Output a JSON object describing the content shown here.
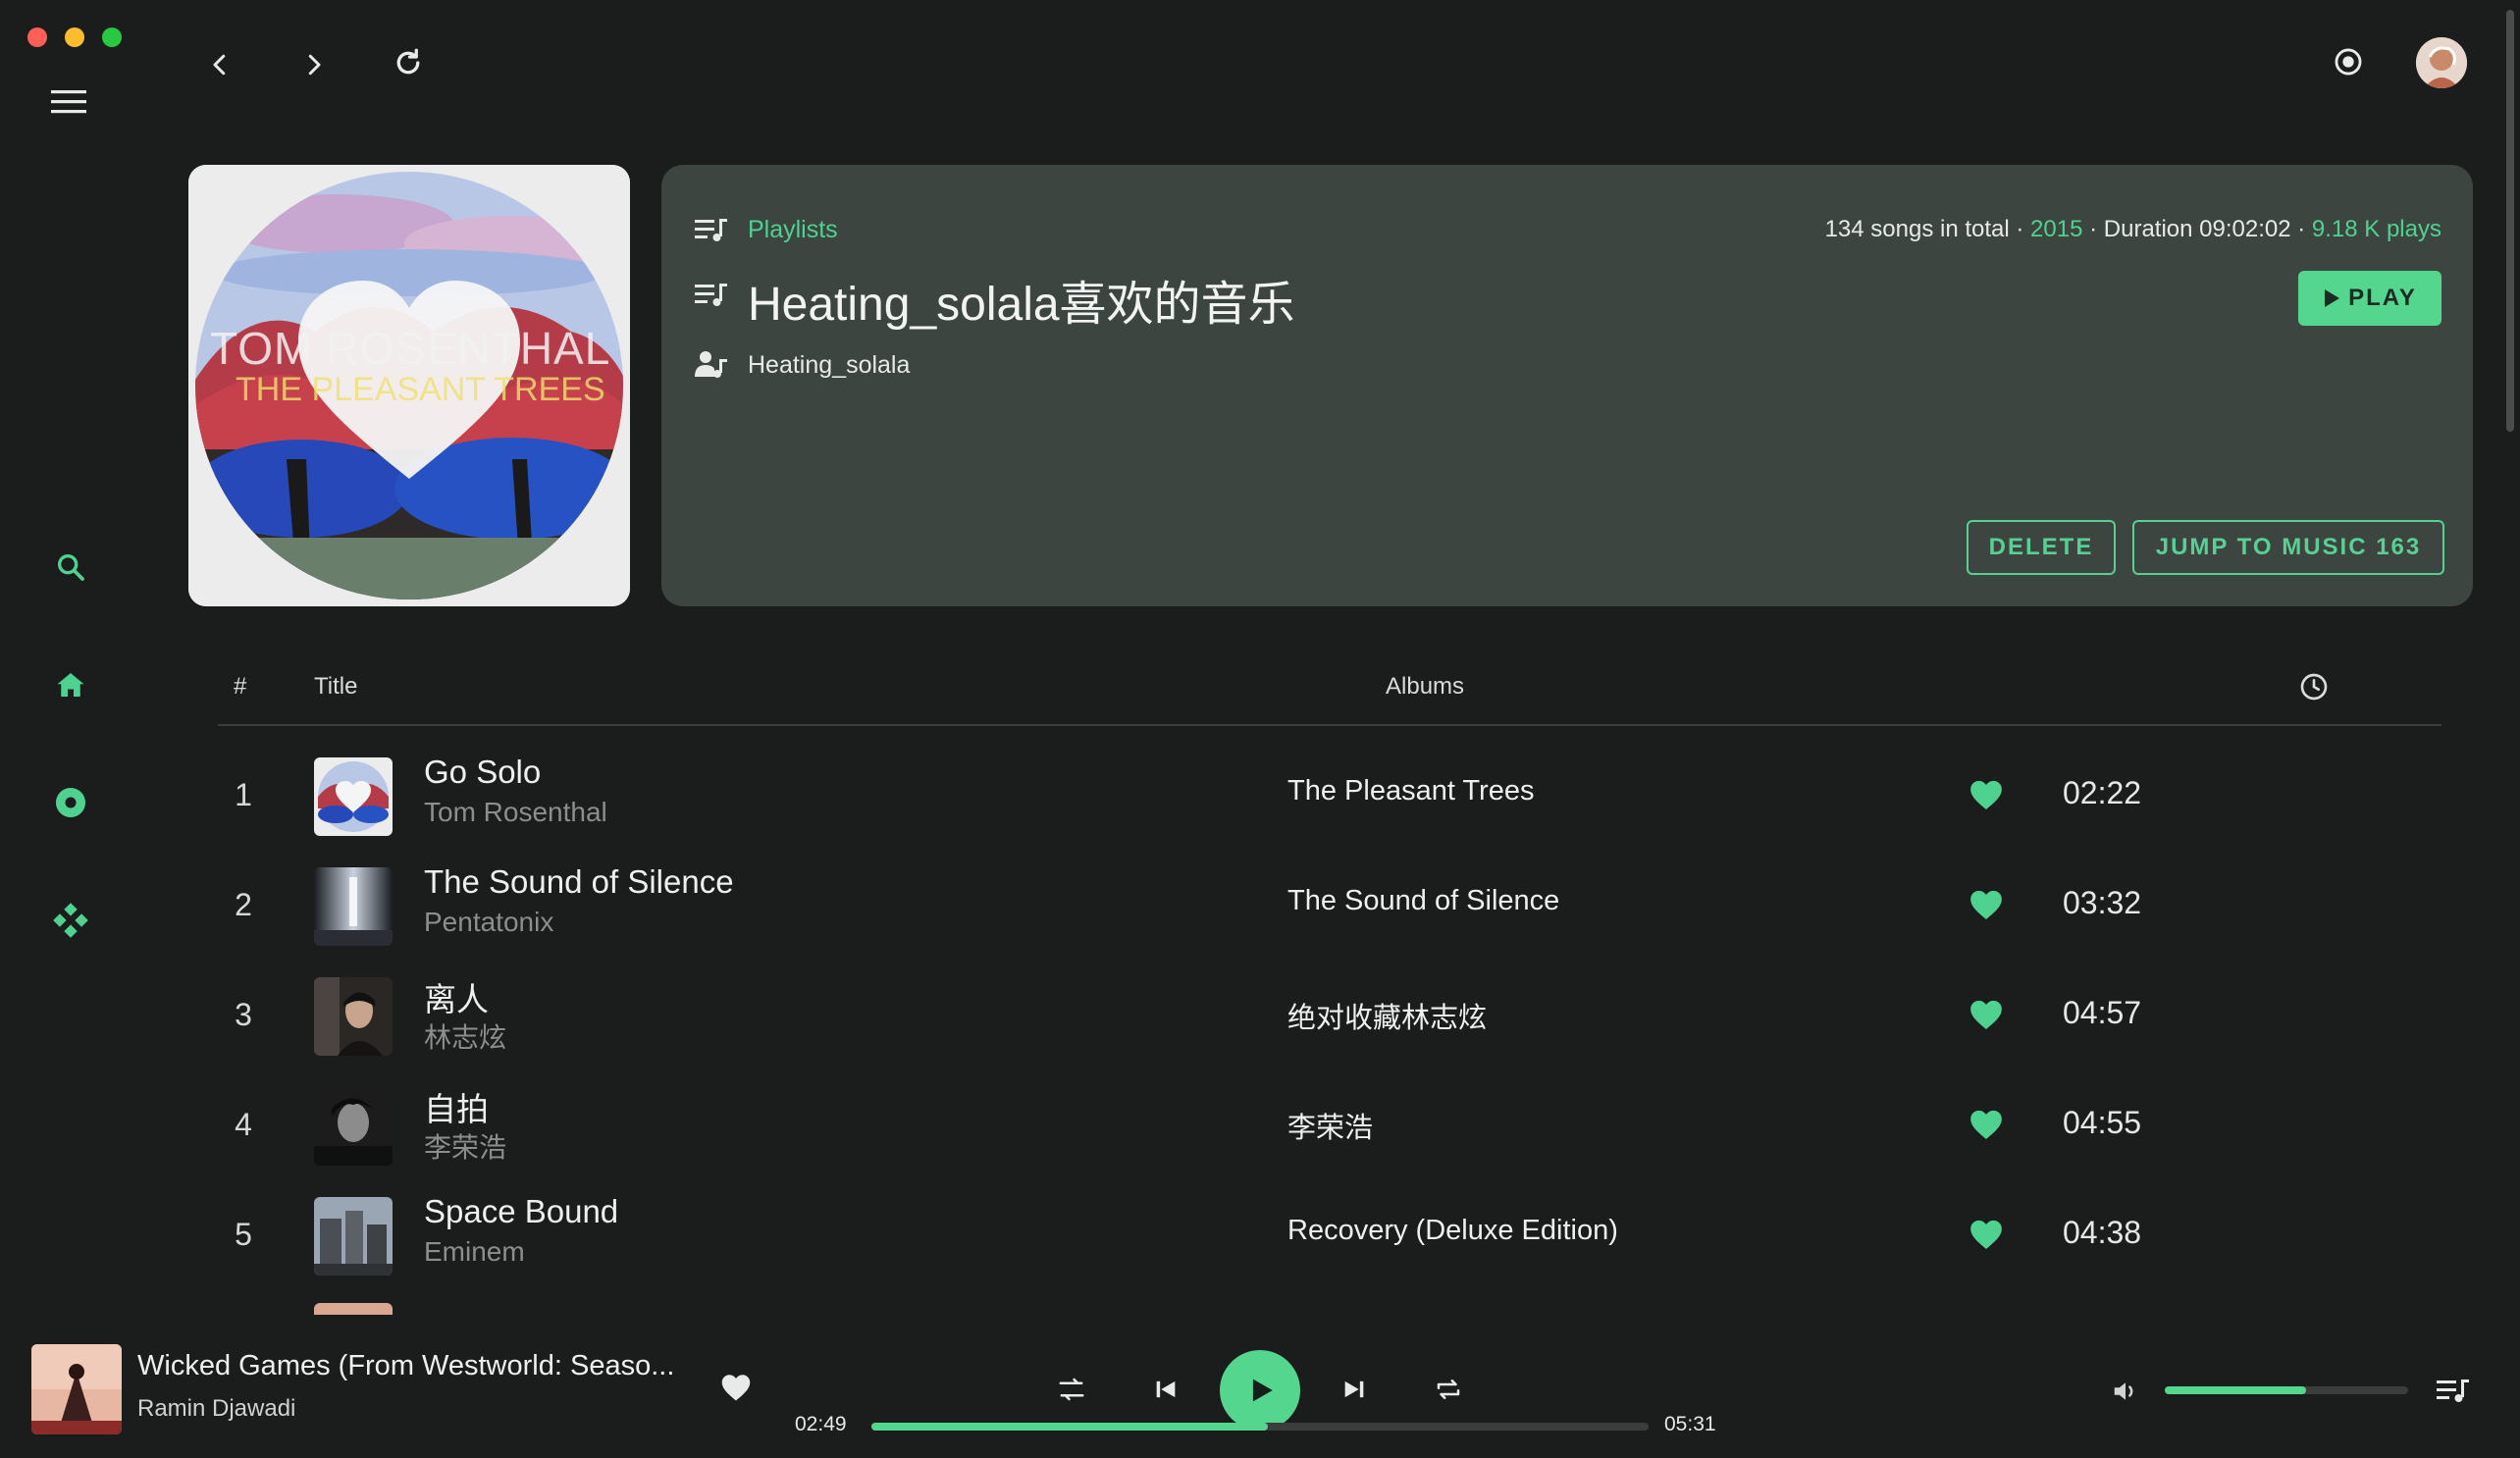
{
  "playlist": {
    "section_label": "Playlists",
    "name": "Heating_solala喜欢的音乐",
    "creator": "Heating_solala",
    "cover_title_line1": "TOM ROSENTHAL",
    "cover_title_line2": "THE PLEASANT TREES",
    "stats_count": "134 songs in total",
    "stats_sep1": " · ",
    "stats_year": "2015",
    "stats_sep2": " · ",
    "stats_duration": "Duration 09:02:02",
    "stats_sep3": " · ",
    "stats_plays": "9.18 K plays",
    "play_label": "PLAY",
    "delete_label": "DELETE",
    "jump_label": "JUMP TO MUSIC 163"
  },
  "table": {
    "col_num": "#",
    "col_title": "Title",
    "col_albums": "Albums",
    "tracks": [
      {
        "num": "1",
        "title": "Go Solo",
        "artist": "Tom Rosenthal",
        "album": "The Pleasant Trees",
        "duration": "02:22"
      },
      {
        "num": "2",
        "title": "The Sound of Silence",
        "artist": "Pentatonix",
        "album": "The Sound of Silence",
        "duration": "03:32"
      },
      {
        "num": "3",
        "title": "离人",
        "artist": "林志炫",
        "album": "绝对收藏林志炫",
        "duration": "04:57"
      },
      {
        "num": "4",
        "title": "自拍",
        "artist": "李荣浩",
        "album": "李荣浩",
        "duration": "04:55"
      },
      {
        "num": "5",
        "title": "Space Bound",
        "artist": "Eminem",
        "album": "Recovery (Deluxe Edition)",
        "duration": "04:38"
      }
    ]
  },
  "player": {
    "title": "Wicked Games (From Westworld: Seaso...",
    "artist": "Ramin Djawadi",
    "current_time": "02:49",
    "total_time": "05:31",
    "progress": 0.51,
    "volume": 0.58
  },
  "colors": {
    "accent": "#4fd28f",
    "background": "#1b1c1c",
    "card": "#3d4540"
  }
}
